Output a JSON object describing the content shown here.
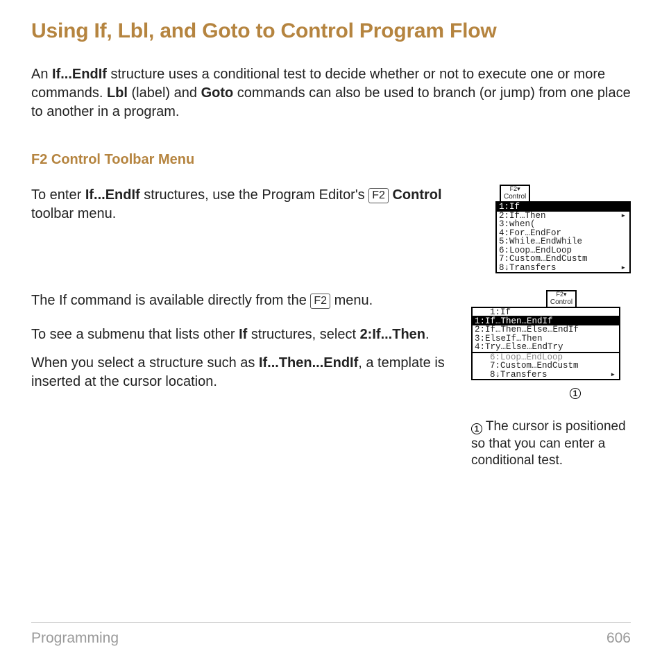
{
  "title": "Using If, Lbl, and Goto to Control Program Flow",
  "intro_parts": {
    "p1": "An ",
    "b1": "If...EndIf",
    "p2": " structure uses a conditional test to decide whether or not to execute one or more commands. ",
    "b2": "Lbl",
    "p3": " (label) and ",
    "b3": "Goto",
    "p4": " commands can also be used to branch (or jump) from one place to another in a program."
  },
  "section_heading": "F2 Control Toolbar Menu",
  "para1": {
    "a": "To enter ",
    "b": "If...EndIf",
    "c": " structures, use the Program Editor's ",
    "key": "F2",
    "d": " ",
    "e": "Control",
    "f": " toolbar menu."
  },
  "para2": {
    "a": "The If command is available directly from the ",
    "key": "F2",
    "b": " menu."
  },
  "para3": {
    "a": "To see a submenu that lists other ",
    "b": "If",
    "c": " structures, select ",
    "d": "2:If...Then",
    "e": "."
  },
  "para4": {
    "a": "When you select a structure such as ",
    "b": "If...Then...EndIf",
    "c": ", a template is inserted at the cursor location."
  },
  "menu_tab_top": "F2▾",
  "menu_tab_bot": "Control",
  "menu1": [
    {
      "t": "1:If",
      "sel": true,
      "arrow": false
    },
    {
      "t": "2:If…Then",
      "sel": false,
      "arrow": true
    },
    {
      "t": "3:when(",
      "sel": false
    },
    {
      "t": "4:For…EndFor",
      "sel": false
    },
    {
      "t": "5:While…EndWhile",
      "sel": false
    },
    {
      "t": "6:Loop…EndLoop",
      "sel": false
    },
    {
      "t": "7:Custom…EndCustm",
      "sel": false
    },
    {
      "t": "8↓Transfers",
      "sel": false,
      "arrow": true
    }
  ],
  "menu2_top": [
    {
      "t": "1:If",
      "sel": false
    }
  ],
  "menu2_sub": [
    {
      "t": "1:If…Then…EndIf",
      "sel": true
    },
    {
      "t": "2:If…Then…Else…EndIf",
      "sel": false
    },
    {
      "t": "3:ElseIf…Then",
      "sel": false
    },
    {
      "t": "4:Try…Else…EndTry",
      "sel": false
    }
  ],
  "menu2_tail": [
    {
      "t": "6:Loop…EndLoop",
      "sel": false,
      "dim": true
    },
    {
      "t": "7:Custom…EndCustm",
      "sel": false
    },
    {
      "t": "8↓Transfers",
      "sel": false,
      "arrow": true
    }
  ],
  "circ_glyph": "1",
  "note": " The cursor is positioned so that you can enter a conditional test.",
  "footer_left": "Programming",
  "footer_right": "606"
}
